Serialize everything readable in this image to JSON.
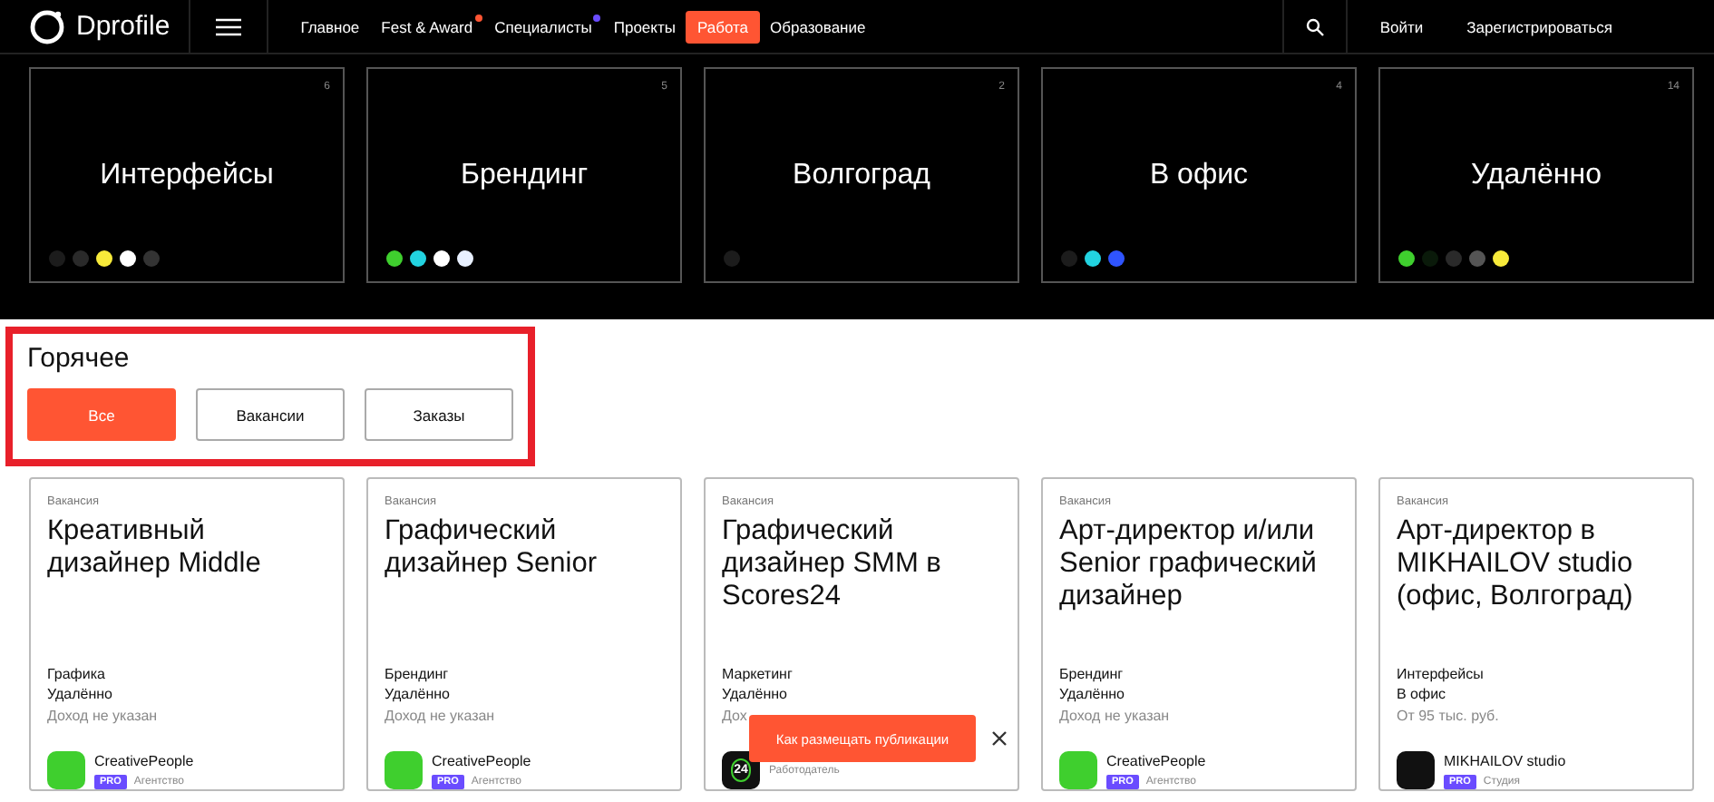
{
  "header": {
    "brand": "Dprofile",
    "nav": [
      {
        "label": "Главное",
        "selected": false
      },
      {
        "label": "Fest & Award",
        "selected": false,
        "dot": {
          "color": "#ff5533"
        }
      },
      {
        "label": "Специалисты",
        "selected": false,
        "dot": {
          "color": "#6a4cff"
        }
      },
      {
        "label": "Проекты",
        "selected": false
      },
      {
        "label": "Работа",
        "selected": true
      },
      {
        "label": "Образование",
        "selected": false
      }
    ],
    "actions": [
      "Войти",
      "Зарегистрироваться"
    ]
  },
  "categories": [
    {
      "title": "Интерфейсы",
      "count": "6",
      "logos": [
        {
          "color": "#1c1c1c"
        },
        {
          "color": "#2a2a2a"
        },
        {
          "color": "#f7ea3a"
        },
        {
          "color": "#ffffff"
        },
        {
          "color": "#333333"
        }
      ]
    },
    {
      "title": "Брендинг",
      "count": "5",
      "logos": [
        {
          "color": "#3fcf2e"
        },
        {
          "color": "#22d3e0"
        },
        {
          "color": "#ffffff"
        },
        {
          "color": "#e8f0ff"
        }
      ]
    },
    {
      "title": "Волгоград",
      "count": "2",
      "logos": [
        {
          "color": "#1c1c1c"
        }
      ]
    },
    {
      "title": "В офис",
      "count": "4",
      "logos": [
        {
          "color": "#1c1c1c"
        },
        {
          "color": "#22d3e0"
        },
        {
          "color": "#2f54ff"
        }
      ]
    },
    {
      "title": "Удалённо",
      "count": "14",
      "logos": [
        {
          "color": "#3fcf2e"
        },
        {
          "color": "#0a1a0a"
        },
        {
          "color": "#2a2a2a"
        },
        {
          "color": "#555555"
        },
        {
          "color": "#f7ea3a"
        }
      ]
    }
  ],
  "hot": {
    "title": "Горячее",
    "annotation": {
      "color": "#e8202a"
    },
    "filters": [
      {
        "label": "Все",
        "selected": true
      },
      {
        "label": "Вакансии",
        "selected": false
      },
      {
        "label": "Заказы",
        "selected": false
      }
    ]
  },
  "jobs": [
    {
      "type": "Вакансия",
      "title": "Креативный дизайнер Middle",
      "category": "Графика",
      "mode": "Удалённо",
      "income": "Доход не указан",
      "company": "CreativePeople",
      "badge": "PRO",
      "company_type": "Агентство",
      "logo": {
        "color": "#3fcf2e"
      }
    },
    {
      "type": "Вакансия",
      "title": "Графический дизайнер Senior",
      "category": "Брендинг",
      "mode": "Удалённо",
      "income": "Доход не указан",
      "company": "CreativePeople",
      "badge": "PRO",
      "company_type": "Агентство",
      "logo": {
        "color": "#3fcf2e"
      }
    },
    {
      "type": "Вакансия",
      "title": "Графический дизайнер SMM в Scores24",
      "category": "Маркетинг",
      "mode": "Удалённо",
      "income": "Дох",
      "company_type": "Работодатель",
      "logo": {
        "color": "#111111",
        "text": "24"
      }
    },
    {
      "type": "Вакансия",
      "title": "Арт-директор и/или Senior графический дизайнер",
      "category": "Брендинг",
      "mode": "Удалённо",
      "income": "Доход не указан",
      "company": "CreativePeople",
      "badge": "PRO",
      "company_type": "Агентство",
      "logo": {
        "color": "#3fcf2e"
      }
    },
    {
      "type": "Вакансия",
      "title": "Арт-директор в MIKHAILOV studio (офис, Волгоград)",
      "category": "Интерфейсы",
      "mode": "В офис",
      "income": "От 95 тыс. руб.",
      "company": "MIKHAILOV studio",
      "badge": "PRO",
      "company_type": "Студия",
      "logo": {
        "color": "#111111"
      }
    }
  ],
  "toast": {
    "text": "Как размещать публикации"
  }
}
